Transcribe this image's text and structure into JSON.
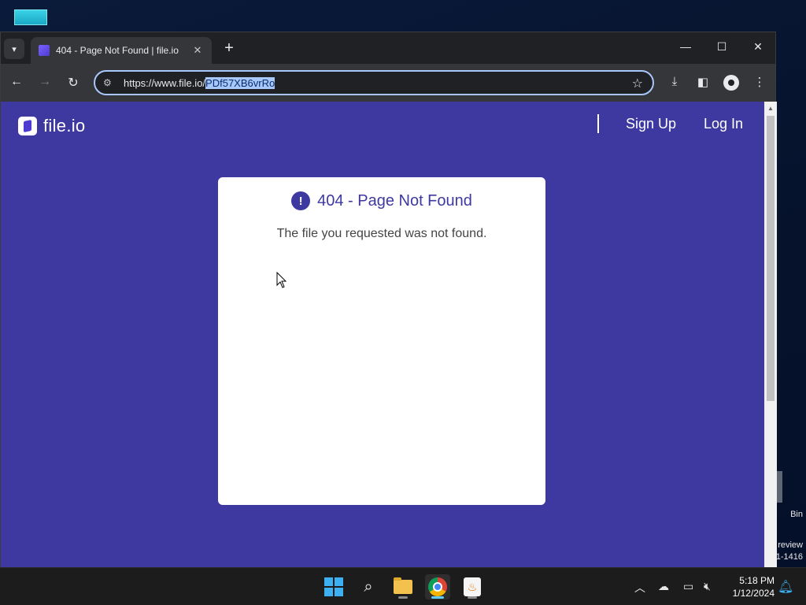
{
  "desktop": {
    "recycle_bin_label": "Bin",
    "preview_line1": "review",
    "preview_line2": "1-1416"
  },
  "browser": {
    "tab": {
      "title": "404 - Page Not Found | file.io",
      "close_glyph": "✕"
    },
    "new_tab_glyph": "+",
    "window_controls": {
      "minimize": "—",
      "maximize": "☐",
      "close": "✕"
    },
    "toolbar": {
      "back_glyph": "←",
      "forward_glyph": "→",
      "reload_glyph": "↻",
      "url_base": "https://www.file.io/",
      "url_selected": "PDf57XB6vrRo",
      "bookmark_glyph": "☆",
      "download_glyph": "⤓",
      "side_panel_glyph": "◧",
      "menu_glyph": "⋮"
    }
  },
  "page": {
    "logo_text": "file.io",
    "nav": {
      "sign_up": "Sign Up",
      "log_in": "Log In"
    },
    "card": {
      "alert_glyph": "!",
      "title": "404 - Page Not Found",
      "message": "The file you requested was not found."
    },
    "colors": {
      "brand": "#3e39a0",
      "card_bg": "#ffffff"
    }
  },
  "taskbar": {
    "apps": [
      "start",
      "search",
      "file-explorer",
      "chrome",
      "java"
    ],
    "active_app": "chrome",
    "clock_time": "5:18 PM",
    "clock_date": "1/12/2024"
  }
}
